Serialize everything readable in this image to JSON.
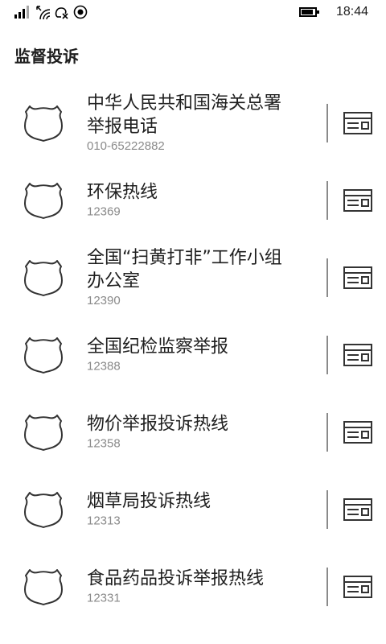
{
  "status_bar": {
    "time": "18:44",
    "battery_level": 0.85,
    "icons": [
      "signal-icon",
      "wifi-icon",
      "ringer-icon",
      "location-icon",
      "battery-icon"
    ]
  },
  "header": {
    "title": "监督投诉"
  },
  "hotlines": [
    {
      "name_lines": [
        "中华人民共和国海关总署",
        "举报电话"
      ],
      "number": "010-65222882"
    },
    {
      "name_lines": [
        "环保热线"
      ],
      "number": "12369"
    },
    {
      "name_lines": [
        "全国“扫黄打非”工作小组",
        "办公室"
      ],
      "number": "12390"
    },
    {
      "name_lines": [
        "全国纪检监察举报"
      ],
      "number": "12388"
    },
    {
      "name_lines": [
        "物价举报投诉热线"
      ],
      "number": "12358"
    },
    {
      "name_lines": [
        "烟草局投诉热线"
      ],
      "number": "12313"
    },
    {
      "name_lines": [
        "食品药品投诉举报热线"
      ],
      "number": "12331"
    }
  ],
  "icons": {
    "row_icon": "shield-icon",
    "row_action_icon": "contact-card-icon"
  },
  "colors": {
    "background": "#ffffff",
    "text": "#1f1f1f",
    "subtext": "#8a8a8a",
    "divider": "#8a8a8a",
    "icon": "#333333"
  }
}
